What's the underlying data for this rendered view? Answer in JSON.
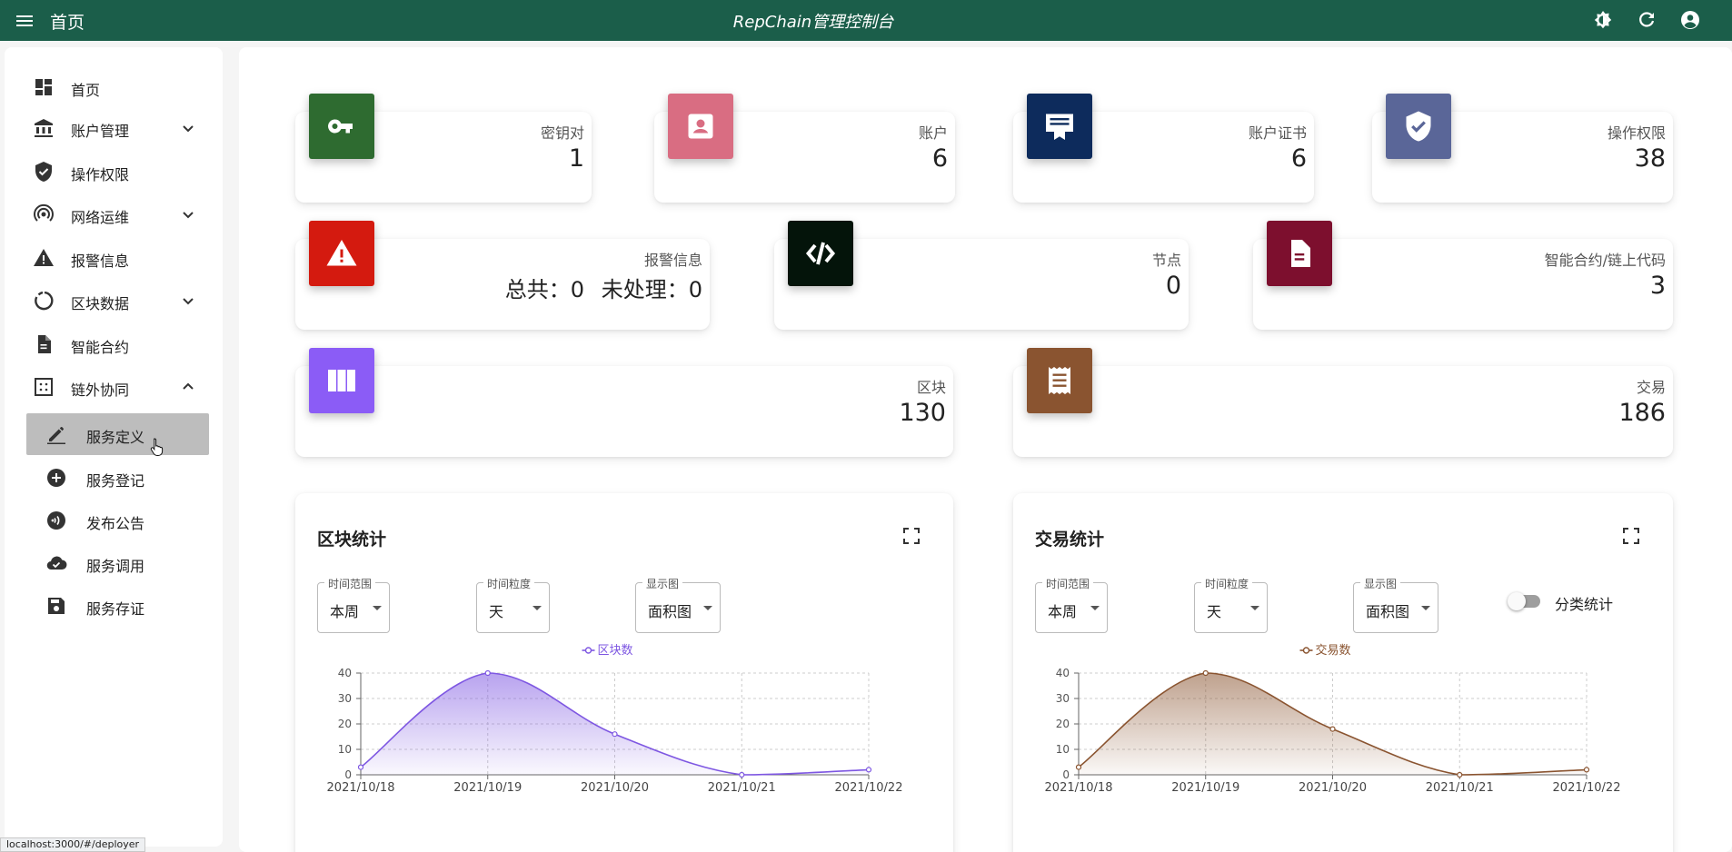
{
  "topbar": {
    "home_label": "首页",
    "app_title": "RepChain管理控制台",
    "icons": [
      "menu-icon",
      "theme-brightness-icon",
      "refresh-icon",
      "account-circle-icon"
    ],
    "bg_color": "#1b5e4a"
  },
  "sidebar": {
    "items": [
      {
        "label": "首页",
        "icon": "dashboard-icon"
      },
      {
        "label": "账户管理",
        "icon": "bank-icon",
        "expandable": true,
        "expanded": false
      },
      {
        "label": "操作权限",
        "icon": "shield-check-icon"
      },
      {
        "label": "网络运维",
        "icon": "network-icon",
        "expandable": true,
        "expanded": false
      },
      {
        "label": "报警信息",
        "icon": "warning-icon"
      },
      {
        "label": "区块数据",
        "icon": "donut-icon",
        "expandable": true,
        "expanded": false
      },
      {
        "label": "智能合约",
        "icon": "document-icon"
      },
      {
        "label": "链外协同",
        "icon": "grid-dots-icon",
        "expandable": true,
        "expanded": true
      }
    ],
    "sub_items": [
      {
        "label": "服务定义",
        "icon": "pencil-icon",
        "active": true
      },
      {
        "label": "服务登记",
        "icon": "plus-circle-icon"
      },
      {
        "label": "发布公告",
        "icon": "broadcast-icon"
      },
      {
        "label": "服务调用",
        "icon": "cloud-check-icon"
      },
      {
        "label": "服务存证",
        "icon": "save-icon"
      }
    ]
  },
  "status_url": "localhost:3000/#/deployer",
  "cards": {
    "keypair": {
      "label": "密钥对",
      "value": "1",
      "color": "#2e6b30"
    },
    "account": {
      "label": "账户",
      "value": "6",
      "color": "#d96d82"
    },
    "cert": {
      "label": "账户证书",
      "value": "6",
      "color": "#0d2b5c"
    },
    "permission": {
      "label": "操作权限",
      "value": "38",
      "color": "#5a6698"
    },
    "alarm": {
      "label": "报警信息",
      "total_text": "总共：0",
      "pending_text": "未处理：0",
      "color": "#d41a0f"
    },
    "node": {
      "label": "节点",
      "value": "0",
      "color": "#04140a"
    },
    "contract": {
      "label": "智能合约/链上代码",
      "value": "3",
      "color": "#7d0f2e"
    },
    "block": {
      "label": "区块",
      "value": "130",
      "color": "#8b5cf6"
    },
    "tx": {
      "label": "交易",
      "value": "186",
      "color": "#8a5430"
    }
  },
  "block_stats": {
    "title": "区块统计",
    "time_range": {
      "legend": "时间范围",
      "value": "本周"
    },
    "granularity": {
      "legend": "时间粒度",
      "value": "天"
    },
    "chart_kind": {
      "legend": "显示图",
      "value": "面积图"
    }
  },
  "tx_stats": {
    "title": "交易统计",
    "time_range": {
      "legend": "时间范围",
      "value": "本周"
    },
    "granularity": {
      "legend": "时间粒度",
      "value": "天"
    },
    "chart_kind": {
      "legend": "显示图",
      "value": "面积图"
    },
    "toggle_label": "分类统计",
    "toggle_on": false
  },
  "chart_data": [
    {
      "type": "area",
      "x": [
        "2021/10/18",
        "2021/10/19",
        "2021/10/20",
        "2021/10/21",
        "2021/10/22"
      ],
      "series": [
        {
          "name": "区块数",
          "values": [
            3,
            40,
            16,
            0,
            2
          ],
          "color": "#7e57e2"
        }
      ],
      "ylim": [
        0,
        40
      ],
      "yticks": [
        0,
        10,
        20,
        30,
        40
      ],
      "grid": true,
      "legend": "top-center"
    },
    {
      "type": "area",
      "x": [
        "2021/10/18",
        "2021/10/19",
        "2021/10/20",
        "2021/10/21",
        "2021/10/22"
      ],
      "series": [
        {
          "name": "交易数",
          "values": [
            3,
            40,
            18,
            0,
            2
          ],
          "color": "#8a5430"
        }
      ],
      "ylim": [
        0,
        40
      ],
      "yticks": [
        0,
        10,
        20,
        30,
        40
      ],
      "grid": true,
      "legend": "top-center"
    }
  ]
}
